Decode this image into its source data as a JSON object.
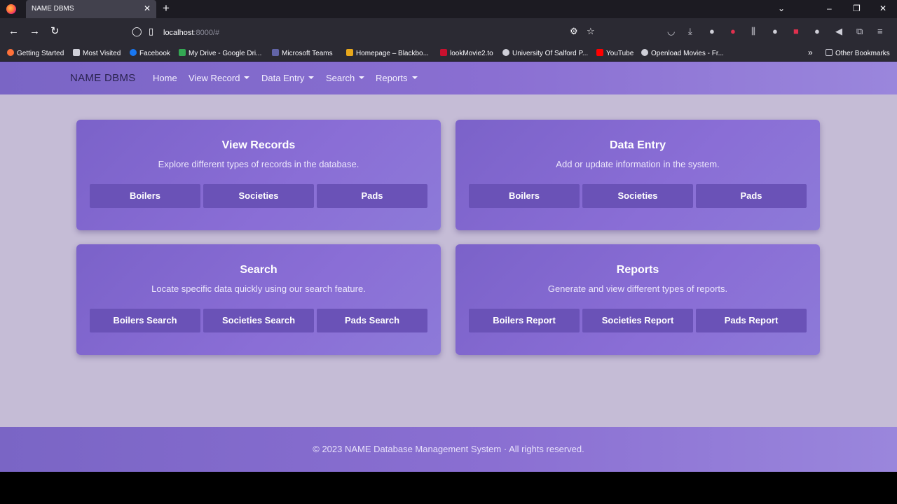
{
  "browser": {
    "tab_title": "NAME DBMS",
    "tab_close": "✕",
    "new_tab": "+",
    "url_host": "localhost",
    "url_rest": ":8000/#",
    "bookmarks": [
      "Getting Started",
      "Most Visited",
      "Facebook",
      "My Drive - Google Dri...",
      "Microsoft Teams",
      "Homepage – Blackbo...",
      "lookMovie2.to",
      "University Of Salford P...",
      "YouTube",
      "Openload Movies - Fr..."
    ],
    "other_bookmarks": "Other Bookmarks"
  },
  "site": {
    "brand": "NAME DBMS",
    "nav": [
      "Home",
      "View Record",
      "Data Entry",
      "Search",
      "Reports"
    ]
  },
  "cards": [
    {
      "title": "View Records",
      "subtitle": "Explore different types of records in the database.",
      "buttons": [
        "Boilers",
        "Societies",
        "Pads"
      ]
    },
    {
      "title": "Data Entry",
      "subtitle": "Add or update information in the system.",
      "buttons": [
        "Boilers",
        "Societies",
        "Pads"
      ]
    },
    {
      "title": "Search",
      "subtitle": "Locate specific data quickly using our search feature.",
      "buttons": [
        "Boilers Search",
        "Societies Search",
        "Pads Search"
      ]
    },
    {
      "title": "Reports",
      "subtitle": "Generate and view different types of reports.",
      "buttons": [
        "Boilers Report",
        "Societies Report",
        "Pads Report"
      ]
    }
  ],
  "footer": "© 2023 NAME Database Management System · All rights reserved.",
  "colors": {
    "accent": "#8a6fd2",
    "card": "#7b62c9",
    "button": "#6a52b7",
    "page_bg": "#c5bcd6"
  }
}
